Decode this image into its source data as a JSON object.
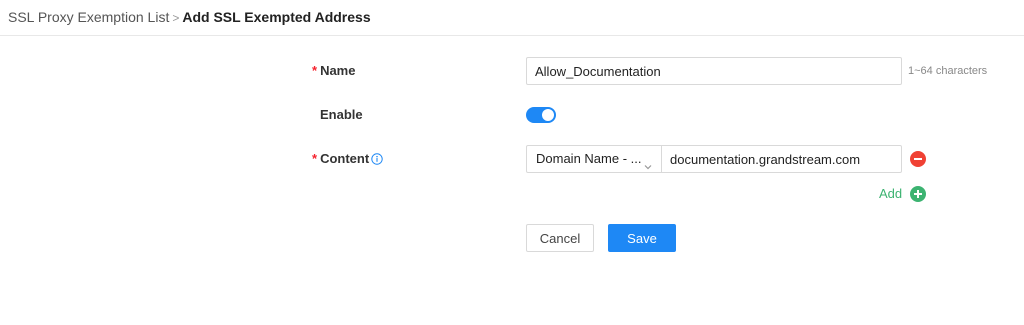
{
  "breadcrumb": {
    "parent": "SSL Proxy Exemption List",
    "separator": ">",
    "current": "Add SSL Exempted Address"
  },
  "form": {
    "name": {
      "required_mark": "*",
      "label": "Name",
      "value": "Allow_Documentation",
      "hint": "1~64 characters"
    },
    "enable": {
      "label": "Enable",
      "state": "on"
    },
    "content": {
      "required_mark": "*",
      "label": "Content",
      "type_selected": "Domain Name - ...",
      "value": "documentation.grandstream.com",
      "add_label": "Add"
    }
  },
  "actions": {
    "cancel_label": "Cancel",
    "save_label": "Save"
  },
  "colors": {
    "accent": "#1e88f5",
    "required": "#f5222d",
    "remove": "#f04134",
    "add": "#3cb371"
  },
  "icons": {
    "info": "info-circle-icon",
    "chevron": "chevron-down-icon",
    "remove": "minus-circle-icon",
    "add": "plus-circle-icon"
  }
}
